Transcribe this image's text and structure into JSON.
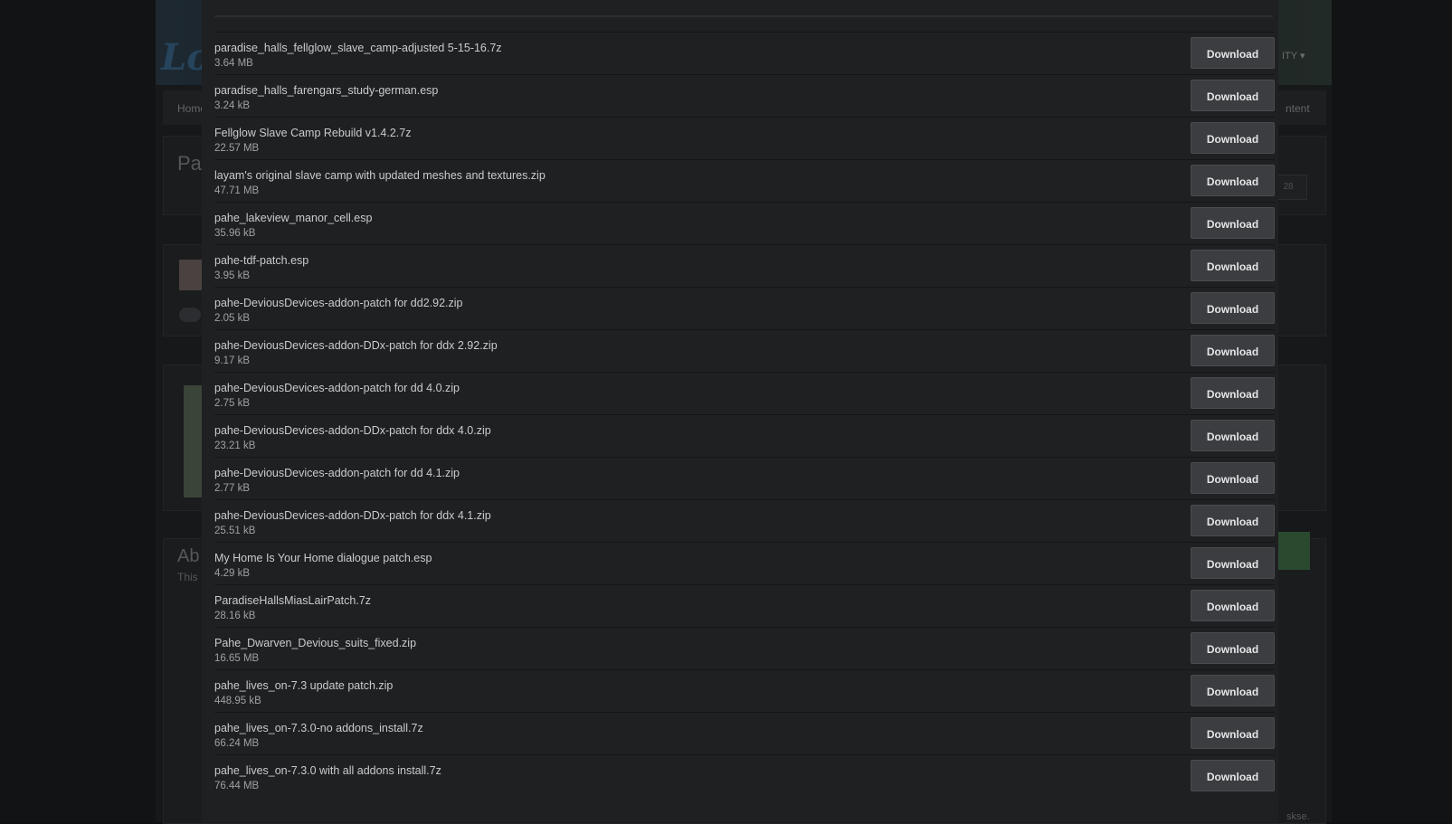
{
  "background_page": {
    "logo_fragment": "Lo",
    "community_menu_fragment": "ITY ▾",
    "nav_home_fragment": "Home",
    "nav_content_fragment": "ntent",
    "title_fragment": "Pa",
    "badge_fragment": "28",
    "about_fragment": "Ab",
    "about_text_fragment": "This",
    "footer_fragment": "skse."
  },
  "files": [
    {
      "name": "paradise_halls_fellglow_slave_camp-adjusted 5-15-16.7z",
      "size": "3.64 MB",
      "button": "Download"
    },
    {
      "name": "paradise_halls_farengars_study-german.esp",
      "size": "3.24 kB",
      "button": "Download"
    },
    {
      "name": "Fellglow Slave Camp Rebuild v1.4.2.7z",
      "size": "22.57 MB",
      "button": "Download"
    },
    {
      "name": "layam's original slave camp with updated meshes and textures.zip",
      "size": "47.71 MB",
      "button": "Download"
    },
    {
      "name": "pahe_lakeview_manor_cell.esp",
      "size": "35.96 kB",
      "button": "Download"
    },
    {
      "name": "pahe-tdf-patch.esp",
      "size": "3.95 kB",
      "button": "Download"
    },
    {
      "name": "pahe-DeviousDevices-addon-patch for dd2.92.zip",
      "size": "2.05 kB",
      "button": "Download"
    },
    {
      "name": "pahe-DeviousDevices-addon-DDx-patch for ddx 2.92.zip",
      "size": "9.17 kB",
      "button": "Download"
    },
    {
      "name": "pahe-DeviousDevices-addon-patch for dd 4.0.zip",
      "size": "2.75 kB",
      "button": "Download"
    },
    {
      "name": "pahe-DeviousDevices-addon-DDx-patch for ddx 4.0.zip",
      "size": "23.21 kB",
      "button": "Download"
    },
    {
      "name": "pahe-DeviousDevices-addon-patch for dd 4.1.zip",
      "size": "2.77 kB",
      "button": "Download"
    },
    {
      "name": "pahe-DeviousDevices-addon-DDx-patch for ddx 4.1.zip",
      "size": "25.51 kB",
      "button": "Download"
    },
    {
      "name": "My Home Is Your Home dialogue patch.esp",
      "size": "4.29 kB",
      "button": "Download"
    },
    {
      "name": "ParadiseHallsMiasLairPatch.7z",
      "size": "28.16 kB",
      "button": "Download"
    },
    {
      "name": "Pahe_Dwarven_Devious_suits_fixed.zip",
      "size": "16.65 MB",
      "button": "Download"
    },
    {
      "name": "pahe_lives_on-7.3 update patch.zip",
      "size": "448.95 kB",
      "button": "Download"
    },
    {
      "name": "pahe_lives_on-7.3.0-no addons_install.7z",
      "size": "66.24 MB",
      "button": "Download"
    },
    {
      "name": "pahe_lives_on-7.3.0 with all addons install.7z",
      "size": "76.44 MB",
      "button": "Download"
    }
  ]
}
